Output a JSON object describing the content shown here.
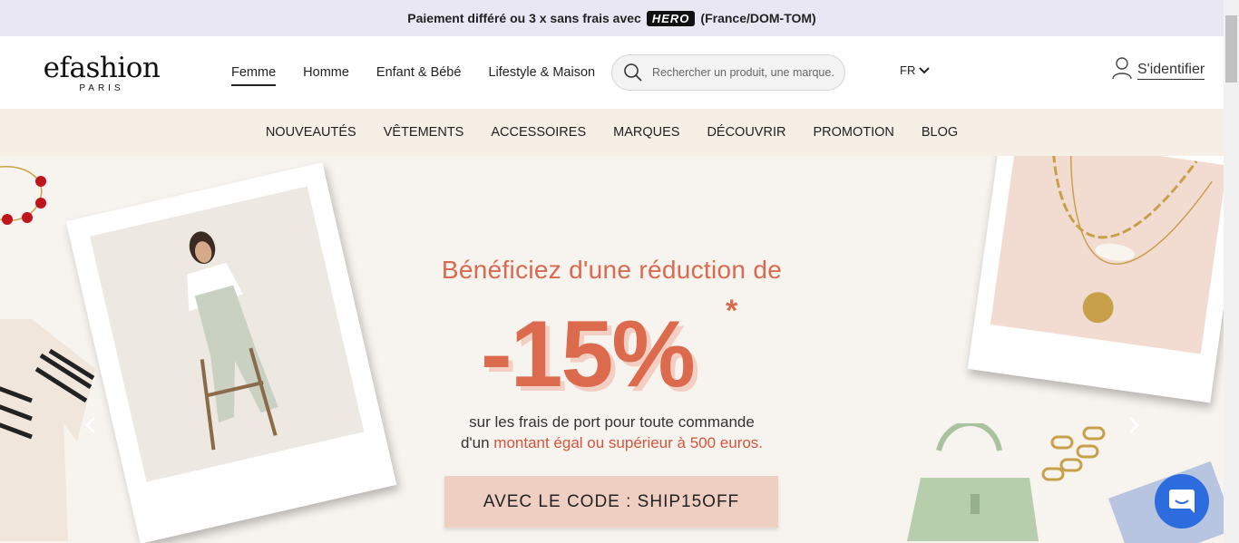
{
  "announcement": {
    "before": "Paiement différé ou 3 x sans frais avec",
    "badge": "HERO",
    "after": "(France/DOM-TOM)"
  },
  "logo": {
    "main": "efashion",
    "sub": "PARIS"
  },
  "main_nav": [
    "Femme",
    "Homme",
    "Enfant & Bébé",
    "Lifestyle & Maison"
  ],
  "search": {
    "placeholder": "Rechercher un produit, une marque..."
  },
  "language": "FR",
  "signin_label": "S'identifier",
  "category_nav": [
    "NOUVEAUTÉS",
    "VÊTEMENTS",
    "ACCESSOIRES",
    "MARQUES",
    "DÉCOUVRIR",
    "PROMOTION",
    "BLOG"
  ],
  "banner": {
    "headline": "Bénéficiez d'une réduction de",
    "discount": "-15%",
    "asterisk": "*",
    "line1": "sur les frais de port pour toute commande",
    "line2_prefix": "d'un ",
    "line2_highlight": "montant égal ou supérieur à 500 euros.",
    "code": "AVEC LE CODE : SHIP15OFF"
  },
  "colors": {
    "accent": "#dc6b4e",
    "topbar": "#e9e7f3",
    "catnav": "#f5efe6",
    "chat": "#2d6cdf"
  }
}
